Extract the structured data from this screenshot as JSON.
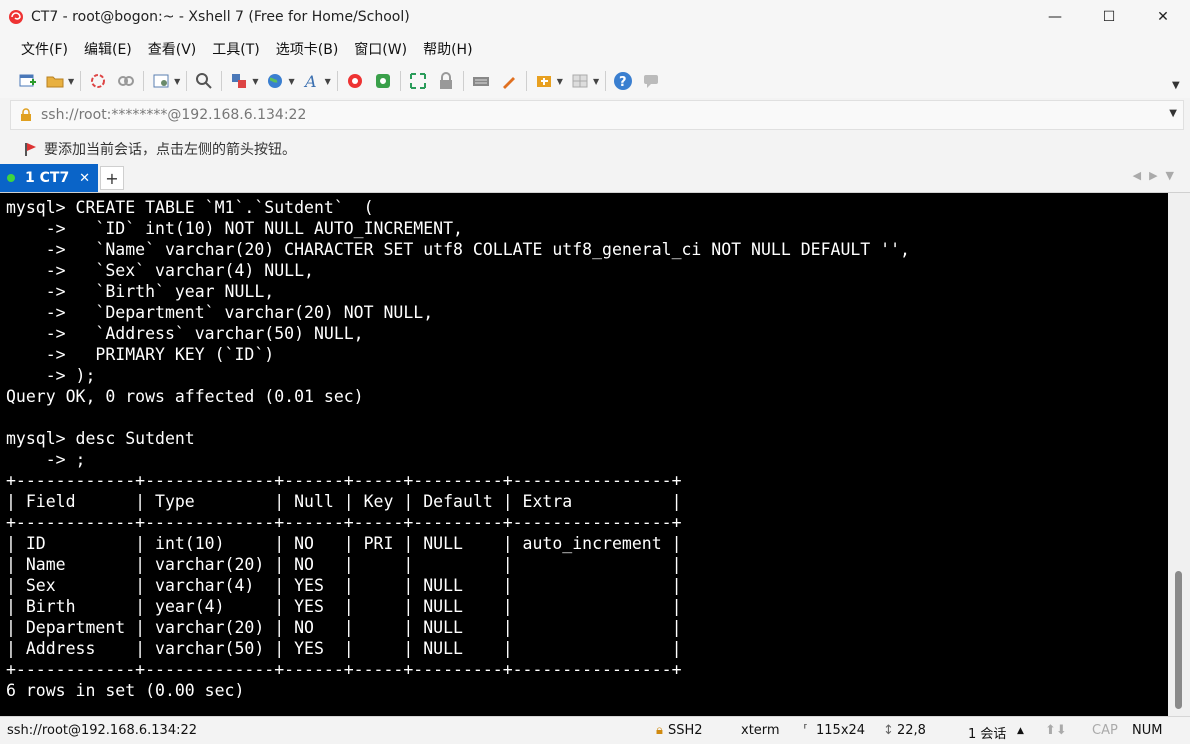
{
  "window": {
    "title": "CT7 - root@bogon:~ - Xshell 7 (Free for Home/School)",
    "controls": {
      "minimize": "—",
      "maximize": "☐",
      "close": "✕"
    }
  },
  "menu": [
    "文件(F)",
    "编辑(E)",
    "查看(V)",
    "工具(T)",
    "选项卡(B)",
    "窗口(W)",
    "帮助(H)"
  ],
  "toolbar_icons": [
    "new-session-icon",
    "open-folder-icon",
    "reconnect-icon",
    "disconnect-icon",
    "properties-icon",
    "find-icon",
    "transfer-icon",
    "globe-icon",
    "font-icon",
    "xftp-icon",
    "xmanager-icon",
    "fullscreen-icon",
    "lock-icon",
    "keyboard-icon",
    "highlight-icon",
    "compose-icon",
    "layout-icon",
    "help-icon",
    "chat-icon"
  ],
  "address": {
    "text": "ssh://root:********@192.168.6.134:22"
  },
  "hint": {
    "text": "要添加当前会话，点击左侧的箭头按钮。"
  },
  "tab": {
    "label": "1 CT7",
    "close": "✕",
    "add": "+"
  },
  "terminal": {
    "lines": [
      "mysql> CREATE TABLE `M1`.`Sutdent`  (",
      "    ->   `ID` int(10) NOT NULL AUTO_INCREMENT,",
      "    ->   `Name` varchar(20) CHARACTER SET utf8 COLLATE utf8_general_ci NOT NULL DEFAULT '',",
      "    ->   `Sex` varchar(4) NULL,",
      "    ->   `Birth` year NULL,",
      "    ->   `Department` varchar(20) NOT NULL,",
      "    ->   `Address` varchar(50) NULL,",
      "    ->   PRIMARY KEY (`ID`)",
      "    -> );",
      "Query OK, 0 rows affected (0.01 sec)",
      "",
      "mysql> desc Sutdent",
      "    -> ;",
      "+------------+-------------+------+-----+---------+----------------+",
      "| Field      | Type        | Null | Key | Default | Extra          |",
      "+------------+-------------+------+-----+---------+----------------+",
      "| ID         | int(10)     | NO   | PRI | NULL    | auto_increment |",
      "| Name       | varchar(20) | NO   |     |         |                |",
      "| Sex        | varchar(4)  | YES  |     | NULL    |                |",
      "| Birth      | year(4)     | YES  |     | NULL    |                |",
      "| Department | varchar(20) | NO   |     | NULL    |                |",
      "| Address    | varchar(50) | YES  |     | NULL    |                |",
      "+------------+-------------+------+-----+---------+----------------+",
      "6 rows in set (0.00 sec)"
    ]
  },
  "status": {
    "connection": "ssh://root@192.168.6.134:22",
    "protocol": "SSH2",
    "terminal_type": "xterm",
    "size": "115x24",
    "cursor": "22,8",
    "sessions": "1 会话",
    "caps": "CAP",
    "num": "NUM"
  }
}
